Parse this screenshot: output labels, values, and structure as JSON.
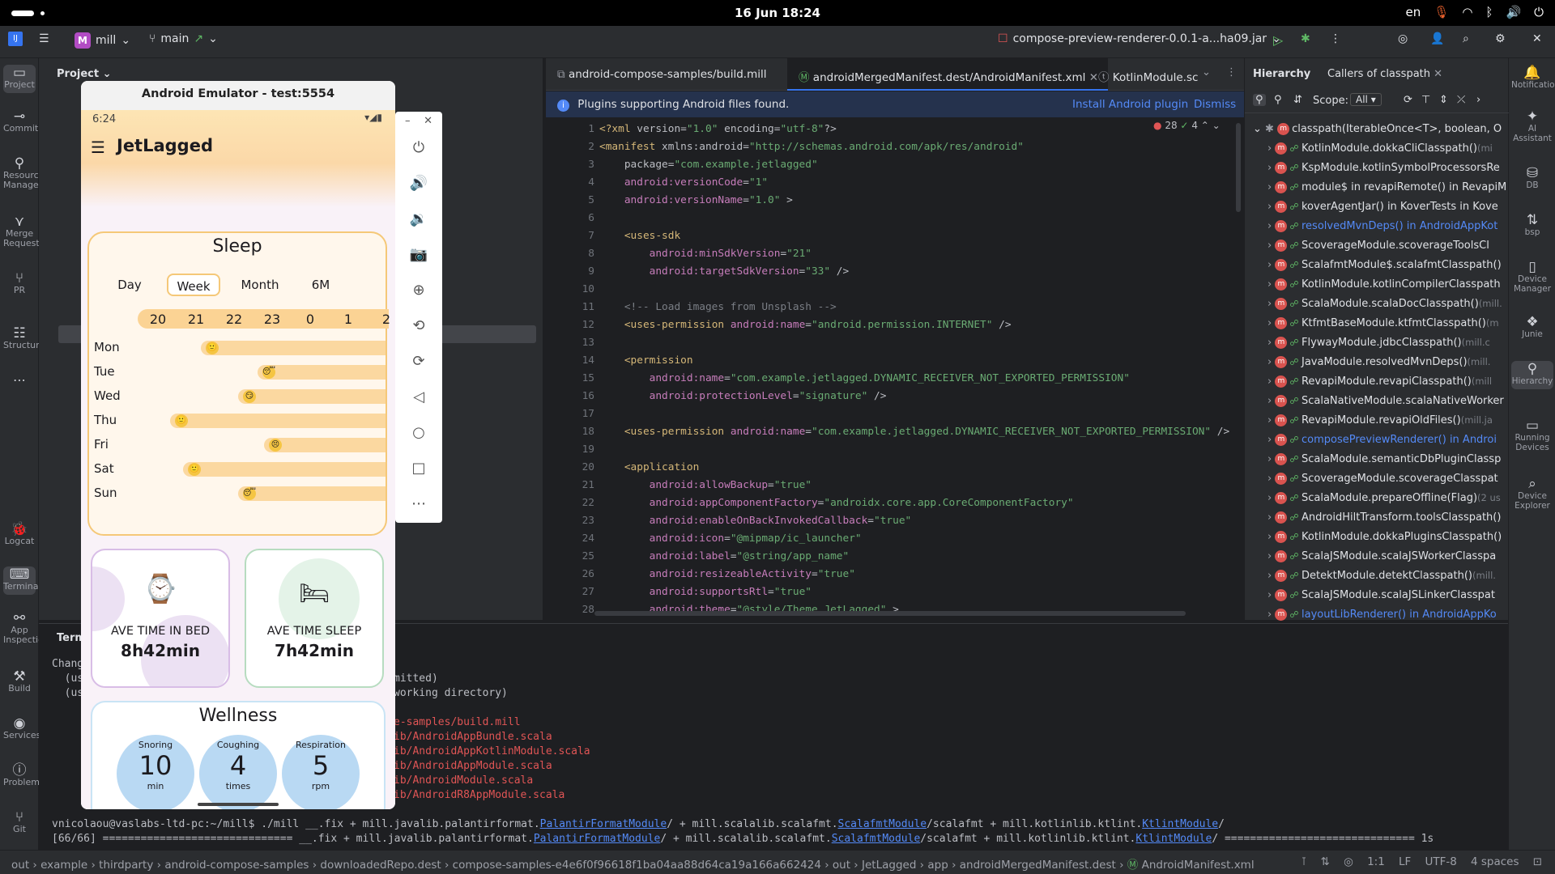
{
  "system": {
    "clock": "16 Jun  18:24",
    "lang": "en"
  },
  "toolbar": {
    "project_letter": "M",
    "project_name": "mill",
    "branch": "main",
    "run_config": "compose-preview-renderer-0.0.1-a...ha09.jar"
  },
  "left_strip": [
    "Project",
    "Commit",
    "Resource Manager",
    "Merge Requests",
    "PR",
    "Structure",
    "Logcat",
    "Terminal",
    "App Inspection",
    "Build",
    "Services",
    "Problems",
    "Git"
  ],
  "right_strip": [
    "Notifications",
    "AI Assistant",
    "DB",
    "bsp",
    "Device Manager",
    "Junie",
    "Hierarchy",
    "Running Devices",
    "Device Explorer"
  ],
  "project_panel": {
    "title": "Project"
  },
  "editor": {
    "tabs": [
      "android-compose-samples/build.mill",
      "androidMergedManifest.dest/AndroidManifest.xml",
      "KotlinModule.sc"
    ],
    "banner": {
      "text": "Plugins supporting Android files found.",
      "install": "Install Android plugin",
      "dismiss": "Dismiss"
    },
    "inspections": {
      "errors": "28",
      "warnings": "4"
    },
    "lines": [
      "<?xml version=\"1.0\" encoding=\"utf-8\"?>",
      "<manifest xmlns:android=\"http://schemas.android.com/apk/res/android\"",
      "    package=\"com.example.jetlagged\"",
      "    android:versionCode=\"1\"",
      "    android:versionName=\"1.0\" >",
      "",
      "    <uses-sdk",
      "        android:minSdkVersion=\"21\"",
      "        android:targetSdkVersion=\"33\" />",
      "",
      "    <!-- Load images from Unsplash -->",
      "    <uses-permission android:name=\"android.permission.INTERNET\" />",
      "",
      "    <permission",
      "        android:name=\"com.example.jetlagged.DYNAMIC_RECEIVER_NOT_EXPORTED_PERMISSION\"",
      "        android:protectionLevel=\"signature\" />",
      "",
      "    <uses-permission android:name=\"com.example.jetlagged.DYNAMIC_RECEIVER_NOT_EXPORTED_PERMISSION\" />",
      "",
      "    <application",
      "        android:allowBackup=\"true\"",
      "        android:appComponentFactory=\"androidx.core.app.CoreComponentFactory\"",
      "        android:enableOnBackInvokedCallback=\"true\"",
      "        android:icon=\"@mipmap/ic_launcher\"",
      "        android:label=\"@string/app_name\"",
      "        android:resizeableActivity=\"true\"",
      "        android:supportsRtl=\"true\"",
      "        android:theme=\"@style/Theme.JetLagged\" >"
    ]
  },
  "hierarchy": {
    "tabs": [
      "Hierarchy",
      "Callers of classpath"
    ],
    "scope_label": "Scope:",
    "scope_value": "All",
    "root": "classpath(IterableOnce<T>, boolean, O",
    "items": [
      {
        "t": "KotlinModule.dokkaCliClasspath()",
        "s": "(mi",
        "link": false
      },
      {
        "t": "KspModule.kotlinSymbolProcessorsRe",
        "s": "",
        "link": false
      },
      {
        "t": "module$ in revapiRemote() in RevapiM",
        "s": "",
        "link": false
      },
      {
        "t": "koverAgentJar() in KoverTests in Kove",
        "s": "",
        "link": false
      },
      {
        "t": "resolvedMvnDeps() in AndroidAppKot",
        "s": "",
        "link": true
      },
      {
        "t": "ScoverageModule.scoverageToolsCl",
        "s": "",
        "link": false
      },
      {
        "t": "ScalafmtModule$.scalafmtClasspath()",
        "s": "",
        "link": false
      },
      {
        "t": "KotlinModule.kotlinCompilerClasspath",
        "s": "",
        "link": false
      },
      {
        "t": "ScalaModule.scalaDocClasspath()",
        "s": "(mill.",
        "link": false
      },
      {
        "t": "KtfmtBaseModule.ktfmtClasspath()",
        "s": "(m",
        "link": false
      },
      {
        "t": "FlywayModule.jdbcClasspath()",
        "s": "(mill.c",
        "link": false
      },
      {
        "t": "JavaModule.resolvedMvnDeps()",
        "s": "(mill.",
        "link": false
      },
      {
        "t": "RevapiModule.revapiClasspath()",
        "s": "(mill",
        "link": false
      },
      {
        "t": "ScalaNativeModule.scalaNativeWorker",
        "s": "",
        "link": false
      },
      {
        "t": "RevapiModule.revapiOldFiles()",
        "s": "(mill.ja",
        "link": false
      },
      {
        "t": "composePreviewRenderer() in Androi",
        "s": "",
        "link": true
      },
      {
        "t": "ScalaModule.semanticDbPluginClassp",
        "s": "",
        "link": false
      },
      {
        "t": "ScoverageModule.scoverageClasspat",
        "s": "",
        "link": false
      },
      {
        "t": "ScalaModule.prepareOffline(Flag)",
        "s": "(2 us",
        "link": false
      },
      {
        "t": "AndroidHiltTransform.toolsClasspath()",
        "s": "",
        "link": false
      },
      {
        "t": "KotlinModule.dokkaPluginsClasspath()",
        "s": "",
        "link": false
      },
      {
        "t": "ScalaJSModule.scalaJSWorkerClasspa",
        "s": "",
        "link": false
      },
      {
        "t": "DetektModule.detektClasspath()",
        "s": "(mill.",
        "link": false
      },
      {
        "t": "ScalaJSModule.scalaJSLinkerClasspat",
        "s": "",
        "link": false
      },
      {
        "t": "layoutLibRenderer() in AndroidAppKo",
        "s": "",
        "link": true
      }
    ]
  },
  "terminal": {
    "tab": "Term",
    "lines": [
      {
        "l": "Chang",
        "r": ""
      },
      {
        "l": "  (us",
        "r": "mitted)"
      },
      {
        "l": "  (us",
        "r": "working directory)"
      },
      {
        "l": "",
        "r": ""
      },
      {
        "l": "",
        "r": "e-samples/build.mill"
      },
      {
        "l": "",
        "r": "ib/AndroidAppBundle.scala"
      },
      {
        "l": "",
        "r": "ib/AndroidAppKotlinModule.scala"
      },
      {
        "l": "",
        "r": "ib/AndroidAppModule.scala"
      },
      {
        "l": "",
        "r": "ib/AndroidModule.scala"
      },
      {
        "l": "",
        "r": "ib/AndroidR8AppModule.scala"
      }
    ],
    "cmd_prompt": "vnicolaou@vaslabs-ltd-pc:~/mill$ ./mill __.fix + mill.javalib.palantirformat.",
    "cmd_l1": "PalantirFormatModule",
    "cmd_mid1": "/ + mill.scalalib.scalafmt.",
    "cmd_l2": "ScalafmtModule",
    "cmd_mid2": "/scalafmt + mill.kotlinlib.ktlint.",
    "cmd_l3": "KtlintModule",
    "cmd_end": "/",
    "prog_start": "[66/66] ============================== __.fix + mill.javalib.palantirformat.",
    "prog_l1": "PalantirFormatModule",
    "prog_mid1": "/ + mill.scalalib.scalafmt.",
    "prog_l2": "ScalafmtModule",
    "prog_mid2": "/scalafmt + mill.kotlinlib.ktlint.",
    "prog_l3": "KtlintModule",
    "prog_end": "/ ============================== 1s"
  },
  "status": {
    "breadcrumb": "out  ›  example  ›  thirdparty  ›  android-compose-samples  ›  downloadedRepo.dest  ›  compose-samples-e4e6f0f96618f1ba04aa88d64ca19a166a662424  ›  out  ›  JetLagged  ›  app  ›  androidMergedManifest.dest  ›",
    "file": "AndroidManifest.xml",
    "pos": "1:1",
    "lf": "LF",
    "enc": "UTF-8",
    "indent": "4 spaces"
  },
  "emulator": {
    "title": "Android Emulator - test:5554",
    "time": "6:24",
    "app_title": "JetLagged",
    "sleep_title": "Sleep",
    "chips": [
      "Day",
      "Week",
      "Month",
      "6M"
    ],
    "hours": [
      "20",
      "21",
      "22",
      "23",
      "0",
      "1",
      "2"
    ],
    "days": [
      "Mon",
      "Tue",
      "Wed",
      "Thu",
      "Fri",
      "Sat",
      "Sun"
    ],
    "bed_label": "AVE TIME IN BED",
    "bed_value": "8h42min",
    "sleep_label": "AVE TIME SLEEP",
    "sleep_value": "7h42min",
    "wellness_title": "Wellness",
    "wellness": [
      {
        "name": "Snoring",
        "value": "10",
        "unit": "min"
      },
      {
        "name": "Coughing",
        "value": "4",
        "unit": "times"
      },
      {
        "name": "Respiration",
        "value": "5",
        "unit": "rpm"
      }
    ]
  }
}
